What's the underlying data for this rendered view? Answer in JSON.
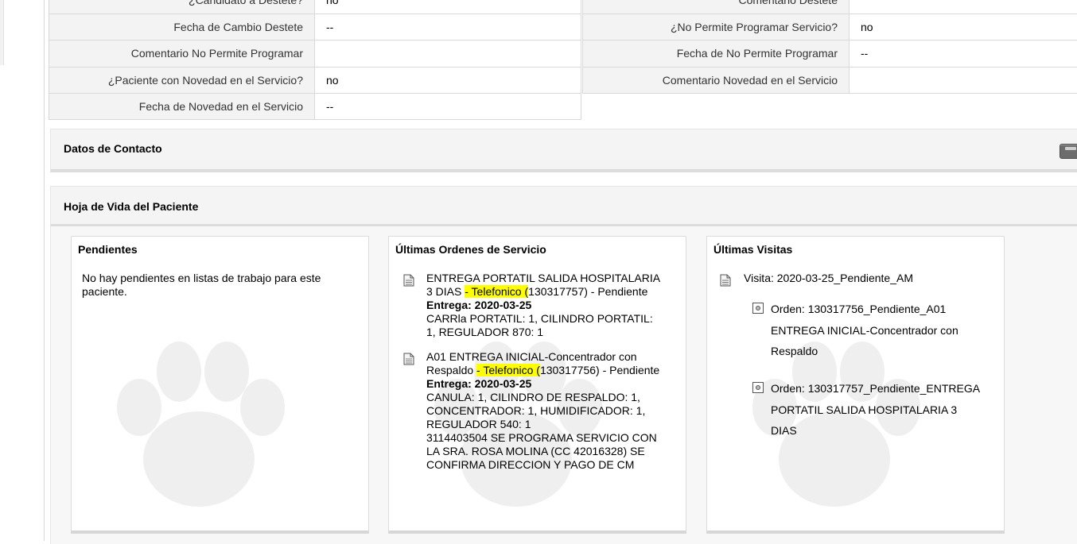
{
  "details": {
    "candidato_destete_label": "¿Candidato a Destete?",
    "candidato_destete_value": "no",
    "comentario_destete_label": "Comentario Destete",
    "comentario_destete_value": "",
    "fecha_cambio_destete_label": "Fecha de Cambio Destete",
    "fecha_cambio_destete_value": "--",
    "no_permite_programar_label": "¿No Permite Programar Servicio?",
    "no_permite_programar_value": "no",
    "comentario_no_permite_label": "Comentario No Permite Programar",
    "comentario_no_permite_value": "",
    "fecha_no_permite_label": "Fecha de No Permite Programar",
    "fecha_no_permite_value": "--",
    "paciente_novedad_label": "¿Paciente con Novedad en el Servicio?",
    "paciente_novedad_value": "no",
    "comentario_novedad_label": "Comentario Novedad en el Servicio",
    "comentario_novedad_value": "",
    "fecha_novedad_label": "Fecha de Novedad en el Servicio",
    "fecha_novedad_value": "--"
  },
  "panels": {
    "contacto_title": "Datos de Contacto",
    "hoja_vida_title": "Hoja de Vida del Paciente"
  },
  "pendientes": {
    "title": "Pendientes",
    "empty_line1": "No hay pendientes en listas de trabajo para este",
    "empty_line2": "paciente."
  },
  "ordenes": {
    "title": "Últimas Ordenes de Servicio",
    "items": [
      {
        "line1": "ENTREGA PORTATIL SALIDA HOSPITALARIA",
        "line2_pre": "3 DIAS ",
        "line2_hl": "- Telefonico (",
        "line2_post": "130317757) - Pendiente",
        "entrega": "Entrega: 2020-03-25",
        "line4": "CARRla PORTATIL: 1, CILINDRO PORTATIL:",
        "line5": "1, REGULADOR 870: 1"
      },
      {
        "line1": "A01 ENTREGA INICIAL-Concentrador con",
        "line2_pre": "Respaldo ",
        "line2_hl": "- Telefonico (",
        "line2_post": "130317756) - Pendiente",
        "entrega": "Entrega: 2020-03-25",
        "line4": "CANULA: 1, CILINDRO DE RESPALDO: 1,",
        "line5": "CONCENTRADOR: 1, HUMIDIFICADOR: 1,",
        "line6": "REGULADOR 540: 1",
        "line7": "3114403504 SE PROGRAMA SERVICIO CON",
        "line8": "LA SRA. ROSA MOLINA (CC 42016328) SE",
        "line9": "CONFIRMA DIRECCION Y PAGO DE CM"
      }
    ]
  },
  "visitas": {
    "title": "Últimas Visitas",
    "visit_label": "Visita: 2020-03-25_Pendiente_AM",
    "orders": [
      {
        "line1": "Orden: 130317756_Pendiente_A01",
        "line2": "ENTREGA INICIAL-Concentrador con",
        "line3": "Respaldo"
      },
      {
        "line1": "Orden: 130317757_Pendiente_ENTREGA",
        "line2": "PORTATIL SALIDA HOSPITALARIA 3",
        "line3": "DIAS"
      }
    ]
  },
  "colors": {
    "highlight": "#ffff00",
    "label_bg": "#f3f3f3",
    "panel_bg": "#f4f4f4"
  }
}
